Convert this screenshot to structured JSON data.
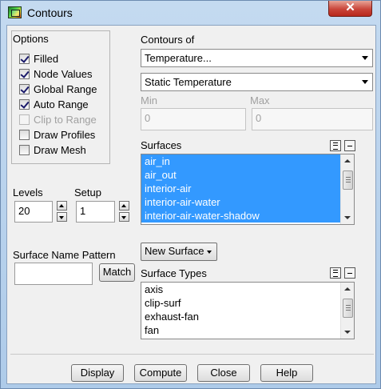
{
  "window": {
    "title": "Contours",
    "close_label": "✕"
  },
  "options": {
    "title": "Options",
    "items": [
      {
        "label": "Filled",
        "checked": true,
        "enabled": true
      },
      {
        "label": "Node Values",
        "checked": true,
        "enabled": true
      },
      {
        "label": "Global Range",
        "checked": true,
        "enabled": true
      },
      {
        "label": "Auto Range",
        "checked": true,
        "enabled": true
      },
      {
        "label": "Clip to Range",
        "checked": false,
        "enabled": false
      },
      {
        "label": "Draw Profiles",
        "checked": false,
        "enabled": true
      },
      {
        "label": "Draw Mesh",
        "checked": false,
        "enabled": true
      }
    ]
  },
  "contours_of": {
    "label": "Contours of",
    "category": "Temperature...",
    "quantity": "Static Temperature"
  },
  "range": {
    "min_label": "Min",
    "min_value": "0",
    "max_label": "Max",
    "max_value": "0"
  },
  "levels": {
    "label": "Levels",
    "value": "20"
  },
  "setup": {
    "label": "Setup",
    "value": "1"
  },
  "surfaces": {
    "label": "Surfaces",
    "items": [
      "air_in",
      "air_out",
      "interior-air",
      "interior-air-water",
      "interior-air-water-shadow"
    ],
    "selected_count": 5
  },
  "surface_name_pattern": {
    "label": "Surface Name Pattern",
    "value": "",
    "match_label": "Match"
  },
  "new_surface": {
    "label": "New Surface"
  },
  "surface_types": {
    "label": "Surface Types",
    "items": [
      "axis",
      "clip-surf",
      "exhaust-fan",
      "fan"
    ]
  },
  "buttons": {
    "display": "Display",
    "compute": "Compute",
    "close": "Close",
    "help": "Help"
  }
}
